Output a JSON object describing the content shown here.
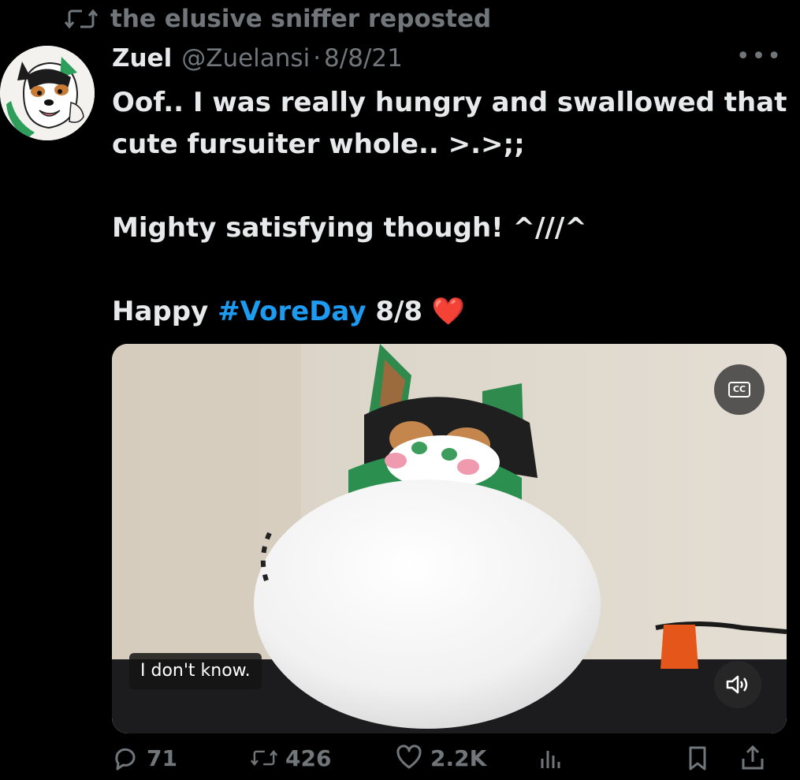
{
  "repost": {
    "icon": "repost-icon",
    "text": "the elusive sniffer reposted"
  },
  "tweet": {
    "author_name": "Zuel",
    "handle": "@Zuelansi",
    "separator": "·",
    "date": "8/8/21",
    "more_icon": "more-icon",
    "lines": {
      "line1": "Oof.. I was really hungry and swallowed that",
      "line2": "cute fursuiter whole.. >.>;;",
      "line3": "Mighty satisfying though! ^///^",
      "line4_prefix": "Happy ",
      "line4_hashtag": "#VoreDay",
      "line4_suffix": " 8/8 ",
      "line4_emoji": "❤️"
    }
  },
  "media": {
    "cc_label": "CC",
    "caption": "I don't know.",
    "volume_icon": "volume-icon"
  },
  "actions": {
    "replies": "71",
    "reposts": "426",
    "likes": "2.2K",
    "views": "",
    "bookmark_icon": "bookmark-icon",
    "share_icon": "share-icon"
  },
  "colors": {
    "background": "#000000",
    "text": "#e7e9ea",
    "muted": "#71767b",
    "link": "#1d9bf0",
    "heart": "#e0313f"
  }
}
